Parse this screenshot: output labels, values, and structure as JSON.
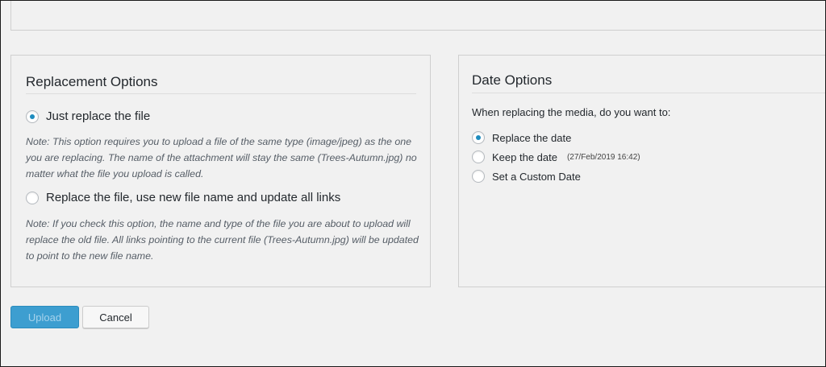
{
  "replacement": {
    "title": "Replacement Options",
    "option_replace": {
      "label": "Just replace the file",
      "checked": true
    },
    "note_replace": "Note: This option requires you to upload a file of the same type (image/jpeg) as the one you are replacing. The name of the attachment will stay the same (Trees-Autumn.jpg) no matter what the file you upload is called.",
    "option_rename": {
      "label": "Replace the file, use new file name and update all links",
      "checked": false
    },
    "note_rename": "Note: If you check this option, the name and type of the file you are about to upload will replace the old file. All links pointing to the current file (Trees-Autumn.jpg) will be updated to point to the new file name."
  },
  "date_options": {
    "title": "Date Options",
    "intro": "When replacing the media, do you want to:",
    "options": [
      {
        "label": "Replace the date",
        "checked": true
      },
      {
        "label": "Keep the date",
        "meta": "(27/Feb/2019 16:42)",
        "checked": false
      },
      {
        "label": "Set a Custom Date",
        "checked": false
      }
    ]
  },
  "actions": {
    "upload_label": "Upload",
    "cancel_label": "Cancel"
  },
  "colors": {
    "accent": "#1e8cbe",
    "upload_button": "#3d9ed0",
    "background": "#f1f1f1"
  }
}
